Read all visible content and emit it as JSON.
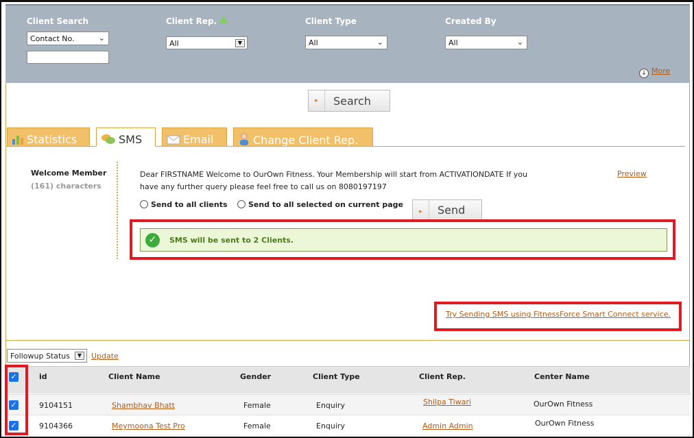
{
  "filters": {
    "client_search": {
      "label": "Client Search",
      "value": "Contact No."
    },
    "client_rep": {
      "label": "Client Rep.",
      "value": "All"
    },
    "client_type": {
      "label": "Client Type",
      "value": "All"
    },
    "created_by": {
      "label": "Created By",
      "value": "All"
    },
    "more_link": "More"
  },
  "search_button": "Search",
  "tabs": [
    {
      "label": "Statistics",
      "icon": "bar-chart-icon"
    },
    {
      "label": "SMS",
      "icon": "chat-bubbles-icon",
      "active": true
    },
    {
      "label": "Email",
      "icon": "envelope-icon"
    },
    {
      "label": "Change Client Rep.",
      "icon": "person-icon"
    }
  ],
  "sms": {
    "template_name": "Welcome Member",
    "char_count": "(161) characters",
    "message_line1": "Dear FIRSTNAME Welcome to OurOwn Fitness. Your Membership will start from ACTIVATIONDATE If you",
    "message_line2": "have any further query please feel free to call us on  8080197197",
    "preview_link": "Preview",
    "radio_all": "Send to all clients",
    "radio_selected": "Send to all selected on current page",
    "send_button": "Send",
    "success_message": "SMS will be sent to 2 Clients.",
    "smart_connect_link": "Try Sending SMS using FitnessForce Smart Connect service."
  },
  "followup": {
    "value": "Followup Status",
    "update_link": "Update"
  },
  "table": {
    "headers": [
      "id",
      "Client Name",
      "Gender",
      "Client Type",
      "Client Rep.",
      "Center Name"
    ],
    "rows": [
      {
        "id": "9104151",
        "name": "Shambhav  Bhatt",
        "gender": "Female",
        "type": "Enquiry",
        "rep": "Shilpa Tiwari",
        "center": "OurOwn Fitness",
        "checked": true
      },
      {
        "id": "9104366",
        "name": "Meymoona Test Pro",
        "gender": "Female",
        "type": "Enquiry",
        "rep": "Admin Admin",
        "center": "OurOwn Fitness",
        "checked": true
      }
    ]
  },
  "colors": {
    "filter_bg": "#a7b4bf",
    "tab_bg": "#f3c06a",
    "link": "#b15a14",
    "highlight_border": "#e01a22",
    "success_bg": "#ecf7d8",
    "success_text": "#4a7a1e",
    "checkbox": "#1a73e8"
  }
}
